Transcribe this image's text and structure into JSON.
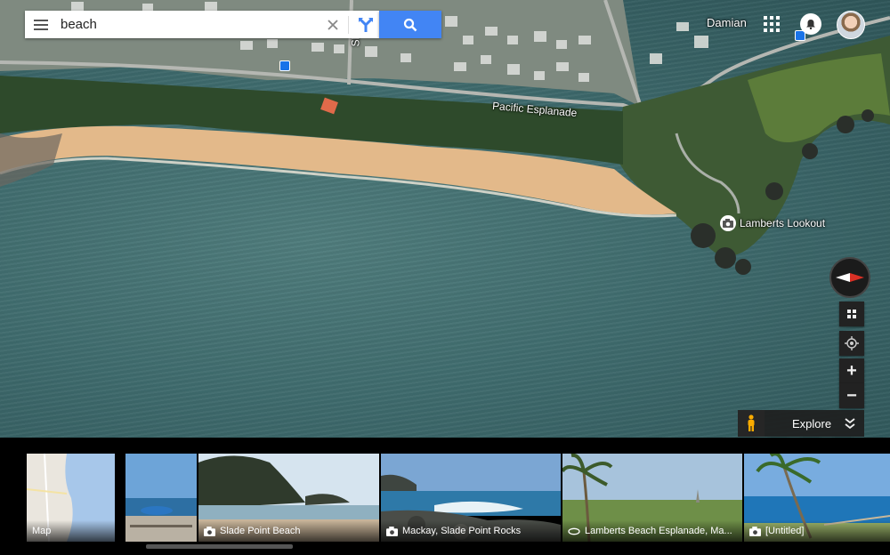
{
  "search": {
    "query": "beach",
    "menu_icon": "hamburger-menu-icon",
    "clear_icon": "close-icon",
    "directions_icon": "directions-icon",
    "search_icon": "search-icon"
  },
  "account": {
    "user_name": "Damian",
    "apps_icon": "apps-grid-icon",
    "notifications_icon": "bell-icon"
  },
  "map": {
    "view": "satellite",
    "road_labels": [
      "Pacific Esplanade",
      "Slade"
    ],
    "poi": {
      "label": "Lamberts Lookout",
      "icon": "camera-icon"
    },
    "colors": {
      "water": "#3f6b6d",
      "sand": "#e4b98a",
      "vegetation": "#2f4a2a"
    }
  },
  "controls": {
    "compass_icon": "compass-icon",
    "layers_icon": "layers-grid-icon",
    "location_icon": "my-location-icon",
    "zoom_in": "+",
    "zoom_out": "−",
    "pegman_icon": "pegman-icon",
    "explore_label": "Explore",
    "explore_toggle_icon": "chevron-down-double-icon"
  },
  "photo_strip": [
    {
      "label": "Map",
      "icon": ""
    },
    {
      "label": "",
      "icon": ""
    },
    {
      "label": "Slade Point Beach",
      "icon": "camera-icon"
    },
    {
      "label": "Mackay, Slade Point Rocks",
      "icon": "camera-icon"
    },
    {
      "label": "Lamberts Beach Esplanade, Ma...",
      "icon": "panorama-360-icon"
    },
    {
      "label": "[Untitled]",
      "icon": "camera-icon"
    }
  ]
}
